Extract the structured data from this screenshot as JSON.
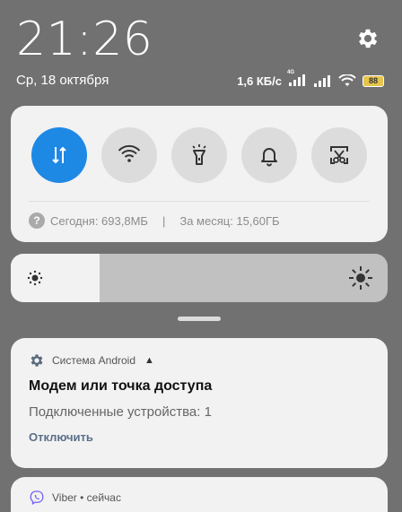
{
  "status": {
    "time": "21:26",
    "date": "Ср, 18 октября",
    "speed": "1,6 КБ/с",
    "network_tag": "4G",
    "battery": "88"
  },
  "quick_settings": {
    "toggles": [
      {
        "name": "mobile-data",
        "icon": "data-arrows-icon",
        "active": true
      },
      {
        "name": "wifi",
        "icon": "wifi-icon",
        "active": false
      },
      {
        "name": "flashlight",
        "icon": "flashlight-icon",
        "active": false
      },
      {
        "name": "sound",
        "icon": "bell-icon",
        "active": false
      },
      {
        "name": "screenshot",
        "icon": "scissors-icon",
        "active": false
      }
    ],
    "usage_today": "Сегодня: 693,8МБ",
    "usage_separator": "|",
    "usage_month": "За месяц: 15,60ГБ"
  },
  "brightness": {
    "level": 0.235
  },
  "notifications": [
    {
      "app": "Система Android",
      "title": "Модем или точка доступа",
      "text": "Подключенные устройства: 1",
      "action": "Отключить"
    },
    {
      "app": "Viber • сейчас"
    }
  ],
  "colors": {
    "accent": "#1e88e5",
    "background": "#717171",
    "card": "#f2f2f2"
  }
}
